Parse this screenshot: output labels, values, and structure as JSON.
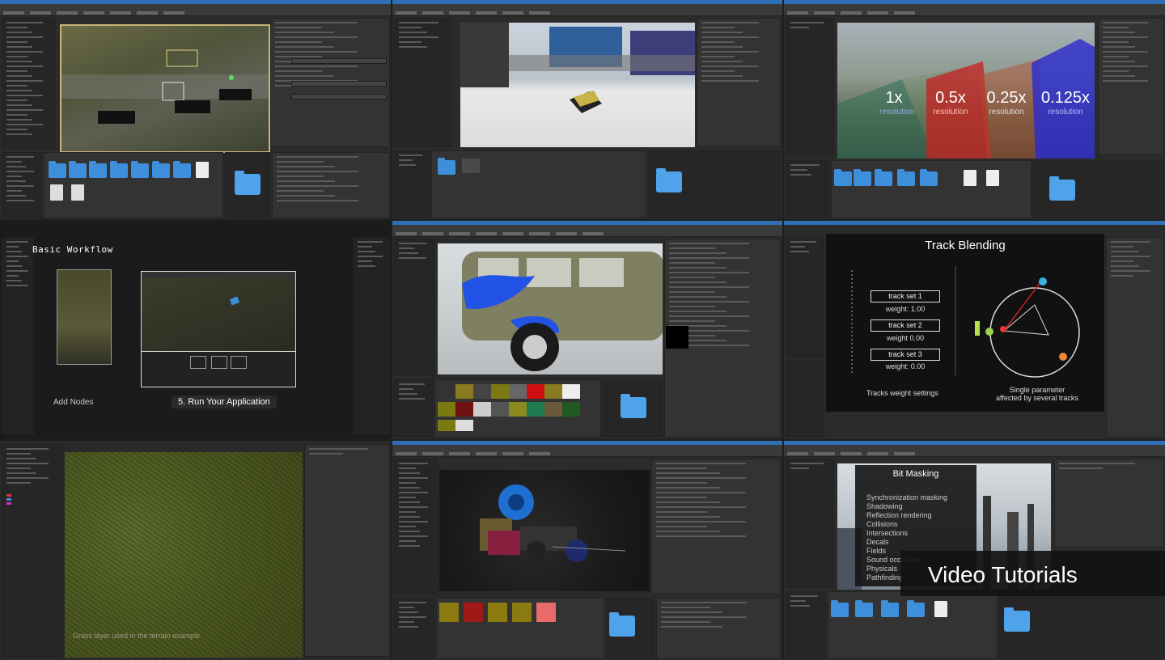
{
  "t1": {},
  "t2": {},
  "t3": {
    "labels": [
      {
        "value": "1x",
        "sub": "resolution"
      },
      {
        "value": "0.5x",
        "sub": "resolution"
      },
      {
        "value": "0.25x",
        "sub": "resolution"
      },
      {
        "value": "0.125x",
        "sub": "resolution"
      }
    ]
  },
  "t4": {
    "header": "Basic Workflow",
    "caption_left": "Add Nodes",
    "step": "5. Run Your Application"
  },
  "t5": {},
  "t6": {
    "title": "Track Blending",
    "tracks": [
      {
        "name": "track set 1",
        "weight": "weight: 1.00"
      },
      {
        "name": "track set 2",
        "weight": "weight 0.00"
      },
      {
        "name": "track set 3",
        "weight": "weight: 0.00"
      }
    ],
    "caption_left": "Tracks weight settings",
    "caption_right_1": "Single parameter",
    "caption_right_2": "affected by several tracks"
  },
  "t7": {
    "caption": "Grass layer used in the terrain example"
  },
  "t8": {},
  "t9": {
    "menu_title": "Bit Masking",
    "items": [
      "Synchronization masking",
      "Shadowing",
      "Reflection rendering",
      "Collisions",
      "Intersections",
      "Decals",
      "Fields",
      "Sound occlusion",
      "Physicals",
      "Pathfinding"
    ],
    "banner": "Video Tutorials"
  },
  "colors": {
    "accent": "#2f6fb5",
    "folder": "#3d8fdb"
  }
}
